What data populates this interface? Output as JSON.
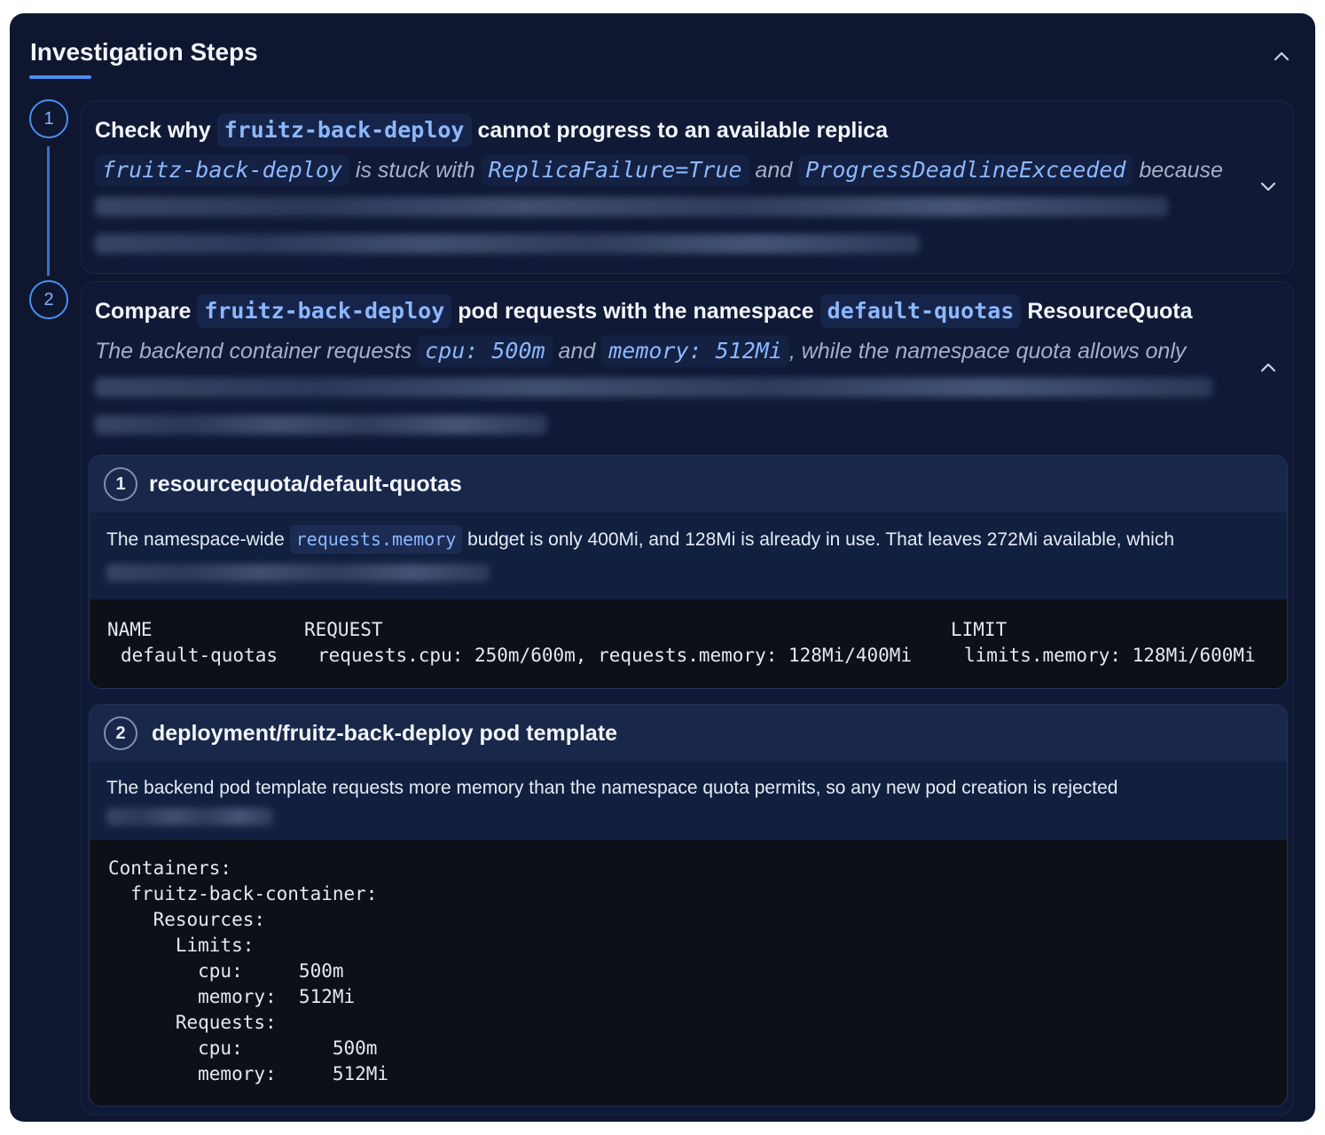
{
  "panel": {
    "title": "Investigation Steps"
  },
  "steps": [
    {
      "number": "1",
      "title": {
        "pre": "Check why",
        "chip": "fruitz-back-deploy",
        "post": "cannot progress to an available replica"
      },
      "description": {
        "chip1": "fruitz-back-deploy",
        "text1": "is stuck with",
        "chip2": "ReplicaFailure=True",
        "text2": "and",
        "chip3": "ProgressDeadlineExceeded",
        "text3": "because"
      }
    },
    {
      "number": "2",
      "title": {
        "pre": "Compare",
        "chip1": "fruitz-back-deploy",
        "mid": "pod requests with the namespace",
        "chip2": "default-quotas",
        "post": "ResourceQuota"
      },
      "description": {
        "text1": "The backend container requests",
        "chip1": "cpu: 500m",
        "text2": "and",
        "chip2": "memory: 512Mi",
        "text3": ", while the namespace quota allows only"
      },
      "evidence": [
        {
          "number": "1",
          "title": "resourcequota/default-quotas",
          "text_pre": "The namespace-wide",
          "text_chip": "requests.memory",
          "text_post": "budget is only 400Mi, and 128Mi is already in use. That leaves 272Mi available, which",
          "code": {
            "headers": [
              "NAME",
              "REQUEST",
              "LIMIT"
            ],
            "row": [
              "default-quotas",
              "requests.cpu: 250m/600m, requests.memory: 128Mi/400Mi",
              "limits.memory: 128Mi/600Mi"
            ]
          }
        },
        {
          "number": "2",
          "title": "deployment/fruitz-back-deploy pod template",
          "text": "The backend pod template requests more memory than the namespace quota permits, so any new pod creation is rejected",
          "code_lines": [
            "Containers:",
            "  fruitz-back-container:",
            "    Resources:",
            "      Limits:",
            "        cpu:     500m",
            "        memory:  512Mi",
            "      Requests:",
            "        cpu:        500m",
            "        memory:     512Mi"
          ]
        }
      ]
    }
  ]
}
